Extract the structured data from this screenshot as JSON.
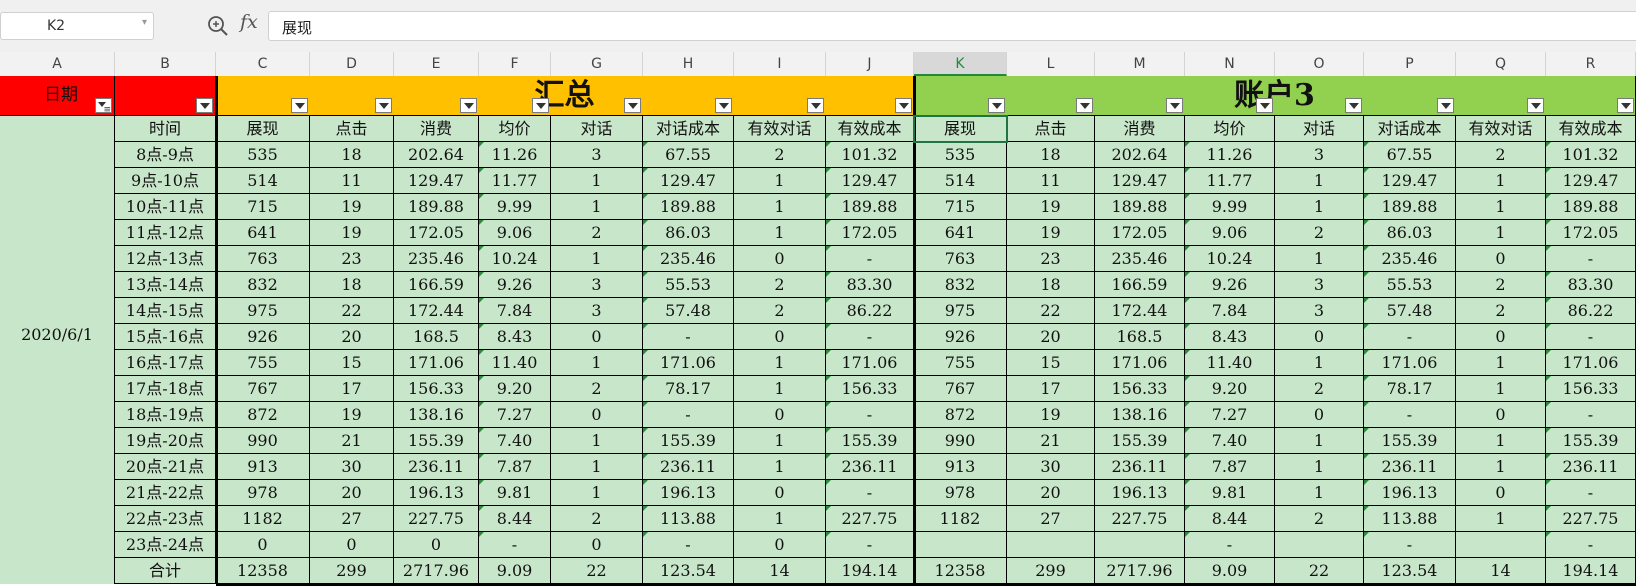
{
  "formula_bar": {
    "cell_ref": "K2",
    "fx_label": "fx",
    "content": "展现"
  },
  "column_letters": [
    "A",
    "B",
    "C",
    "D",
    "E",
    "F",
    "G",
    "H",
    "I",
    "J",
    "K",
    "L",
    "M",
    "N",
    "O",
    "P",
    "Q",
    "R"
  ],
  "selected_column": "K",
  "header_row": {
    "date_label": "日期",
    "summary_title": "汇总",
    "account_title": "账户3"
  },
  "date_value": "2020/6/1",
  "time_header": "时间",
  "metric_headers": [
    "展现",
    "点击",
    "消费",
    "均价",
    "对话",
    "对话成本",
    "有效对话",
    "有效成本"
  ],
  "rows": [
    {
      "time": "8点-9点",
      "summary": [
        "535",
        "18",
        "202.64",
        "11.26",
        "3",
        "67.55",
        "2",
        "101.32"
      ],
      "account": [
        "535",
        "18",
        "202.64",
        "11.26",
        "3",
        "67.55",
        "2",
        "101.32"
      ]
    },
    {
      "time": "9点-10点",
      "summary": [
        "514",
        "11",
        "129.47",
        "11.77",
        "1",
        "129.47",
        "1",
        "129.47"
      ],
      "account": [
        "514",
        "11",
        "129.47",
        "11.77",
        "1",
        "129.47",
        "1",
        "129.47"
      ]
    },
    {
      "time": "10点-11点",
      "summary": [
        "715",
        "19",
        "189.88",
        "9.99",
        "1",
        "189.88",
        "1",
        "189.88"
      ],
      "account": [
        "715",
        "19",
        "189.88",
        "9.99",
        "1",
        "189.88",
        "1",
        "189.88"
      ]
    },
    {
      "time": "11点-12点",
      "summary": [
        "641",
        "19",
        "172.05",
        "9.06",
        "2",
        "86.03",
        "1",
        "172.05"
      ],
      "account": [
        "641",
        "19",
        "172.05",
        "9.06",
        "2",
        "86.03",
        "1",
        "172.05"
      ]
    },
    {
      "time": "12点-13点",
      "summary": [
        "763",
        "23",
        "235.46",
        "10.24",
        "1",
        "235.46",
        "0",
        "-"
      ],
      "account": [
        "763",
        "23",
        "235.46",
        "10.24",
        "1",
        "235.46",
        "0",
        "-"
      ]
    },
    {
      "time": "13点-14点",
      "summary": [
        "832",
        "18",
        "166.59",
        "9.26",
        "3",
        "55.53",
        "2",
        "83.30"
      ],
      "account": [
        "832",
        "18",
        "166.59",
        "9.26",
        "3",
        "55.53",
        "2",
        "83.30"
      ]
    },
    {
      "time": "14点-15点",
      "summary": [
        "975",
        "22",
        "172.44",
        "7.84",
        "3",
        "57.48",
        "2",
        "86.22"
      ],
      "account": [
        "975",
        "22",
        "172.44",
        "7.84",
        "3",
        "57.48",
        "2",
        "86.22"
      ]
    },
    {
      "time": "15点-16点",
      "summary": [
        "926",
        "20",
        "168.5",
        "8.43",
        "0",
        "-",
        "0",
        "-"
      ],
      "account": [
        "926",
        "20",
        "168.5",
        "8.43",
        "0",
        "-",
        "0",
        "-"
      ]
    },
    {
      "time": "16点-17点",
      "summary": [
        "755",
        "15",
        "171.06",
        "11.40",
        "1",
        "171.06",
        "1",
        "171.06"
      ],
      "account": [
        "755",
        "15",
        "171.06",
        "11.40",
        "1",
        "171.06",
        "1",
        "171.06"
      ]
    },
    {
      "time": "17点-18点",
      "summary": [
        "767",
        "17",
        "156.33",
        "9.20",
        "2",
        "78.17",
        "1",
        "156.33"
      ],
      "account": [
        "767",
        "17",
        "156.33",
        "9.20",
        "2",
        "78.17",
        "1",
        "156.33"
      ]
    },
    {
      "time": "18点-19点",
      "summary": [
        "872",
        "19",
        "138.16",
        "7.27",
        "0",
        "-",
        "0",
        "-"
      ],
      "account": [
        "872",
        "19",
        "138.16",
        "7.27",
        "0",
        "-",
        "0",
        "-"
      ]
    },
    {
      "time": "19点-20点",
      "summary": [
        "990",
        "21",
        "155.39",
        "7.40",
        "1",
        "155.39",
        "1",
        "155.39"
      ],
      "account": [
        "990",
        "21",
        "155.39",
        "7.40",
        "1",
        "155.39",
        "1",
        "155.39"
      ]
    },
    {
      "time": "20点-21点",
      "summary": [
        "913",
        "30",
        "236.11",
        "7.87",
        "1",
        "236.11",
        "1",
        "236.11"
      ],
      "account": [
        "913",
        "30",
        "236.11",
        "7.87",
        "1",
        "236.11",
        "1",
        "236.11"
      ]
    },
    {
      "time": "21点-22点",
      "summary": [
        "978",
        "20",
        "196.13",
        "9.81",
        "1",
        "196.13",
        "0",
        "-"
      ],
      "account": [
        "978",
        "20",
        "196.13",
        "9.81",
        "1",
        "196.13",
        "0",
        "-"
      ]
    },
    {
      "time": "22点-23点",
      "summary": [
        "1182",
        "27",
        "227.75",
        "8.44",
        "2",
        "113.88",
        "1",
        "227.75"
      ],
      "account": [
        "1182",
        "27",
        "227.75",
        "8.44",
        "2",
        "113.88",
        "1",
        "227.75"
      ]
    },
    {
      "time": "23点-24点",
      "summary": [
        "0",
        "0",
        "0",
        "-",
        "0",
        "-",
        "0",
        "-"
      ],
      "account": [
        "",
        "",
        "",
        "-",
        "",
        "-",
        "",
        "-"
      ]
    }
  ],
  "total_row": {
    "label": "合计",
    "summary": [
      "12358",
      "299",
      "2717.96",
      "9.09",
      "22",
      "123.54",
      "14",
      "194.14"
    ],
    "account": [
      "12358",
      "299",
      "2717.96",
      "9.09",
      "22",
      "123.54",
      "14",
      "194.14"
    ]
  },
  "colors": {
    "date_header": "#ff0000",
    "summary_header": "#ffc000",
    "account_header": "#92d050",
    "cell_fill": "#c8e6c9",
    "selection": "#217346"
  },
  "icons": [
    "zoom-icon",
    "fx-icon",
    "filter-dropdown-icon"
  ]
}
